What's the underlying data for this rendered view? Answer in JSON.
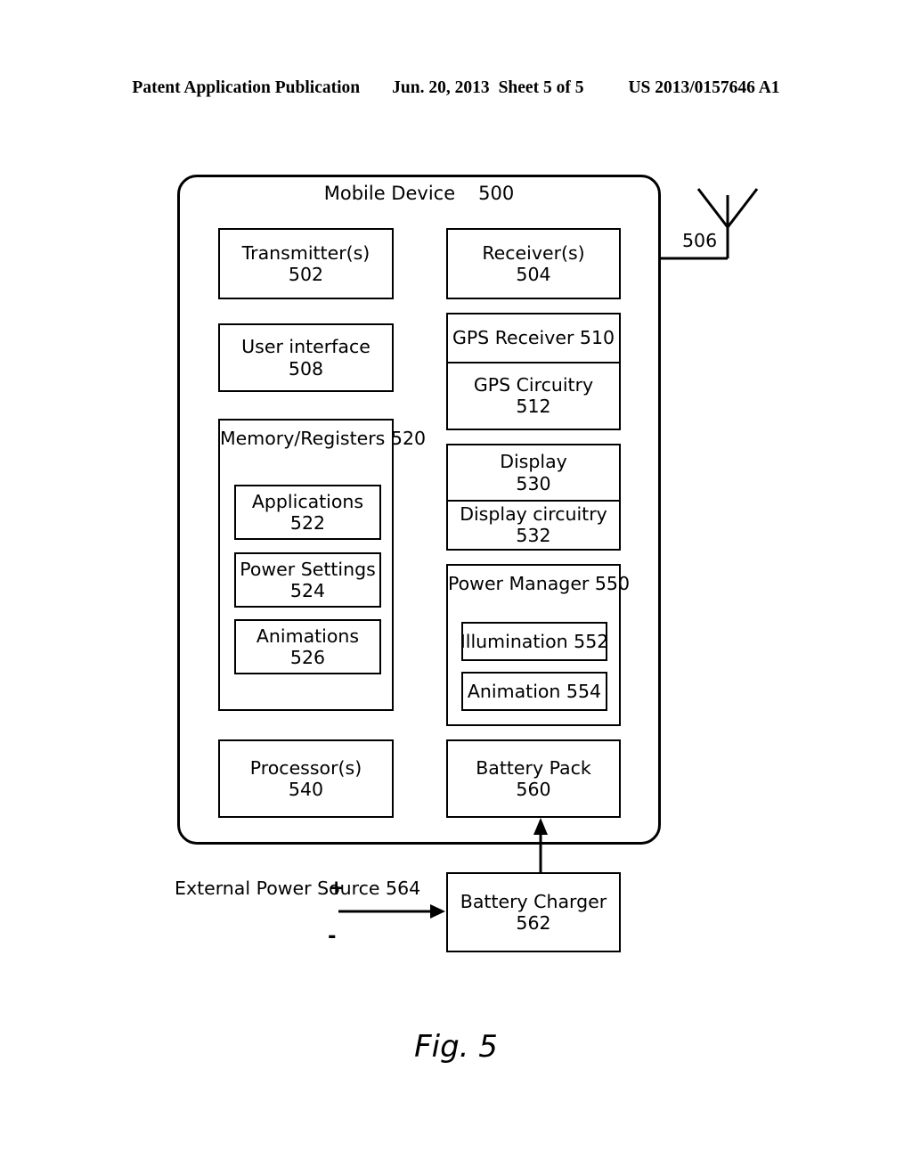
{
  "header": {
    "publication": "Patent Application Publication",
    "date": "Jun. 20, 2013",
    "sheet": "Sheet 5 of 5",
    "patent_number": "US 2013/0157646 A1"
  },
  "figure": {
    "caption": "Fig. 5",
    "device": {
      "title": "Mobile Device",
      "ref": "500"
    },
    "antenna": {
      "ref": "506"
    },
    "blocks": {
      "transmitter": {
        "label": "Transmitter(s)",
        "ref": "502"
      },
      "receiver": {
        "label": "Receiver(s)",
        "ref": "504"
      },
      "user_interface": {
        "label": "User interface",
        "ref": "508"
      },
      "gps_receiver": {
        "label": "GPS Receiver 510"
      },
      "gps_circuitry": {
        "label": "GPS Circuitry",
        "ref": "512"
      },
      "memory": {
        "label": "Memory/Registers",
        "ref": "520"
      },
      "applications": {
        "label": "Applications",
        "ref": "522"
      },
      "power_settings": {
        "label": "Power Settings",
        "ref": "524"
      },
      "animations": {
        "label": "Animations",
        "ref": "526"
      },
      "display": {
        "label": "Display",
        "ref": "530"
      },
      "display_circuitry": {
        "label": "Display circuitry",
        "ref": "532"
      },
      "processor": {
        "label": "Processor(s)",
        "ref": "540"
      },
      "power_manager": {
        "label": "Power Manager",
        "ref": "550"
      },
      "illumination": {
        "label": "Illumination 552"
      },
      "animation": {
        "label": "Animation 554"
      },
      "battery_pack": {
        "label": "Battery Pack",
        "ref": "560"
      },
      "battery_charger": {
        "label": "Battery Charger",
        "ref": "562"
      },
      "external_power": {
        "line1": "External",
        "line2": "Power Source",
        "ref": "564",
        "plus": "+",
        "minus": "-"
      }
    }
  },
  "colors": {
    "ink": "#000000",
    "paper": "#ffffff"
  }
}
